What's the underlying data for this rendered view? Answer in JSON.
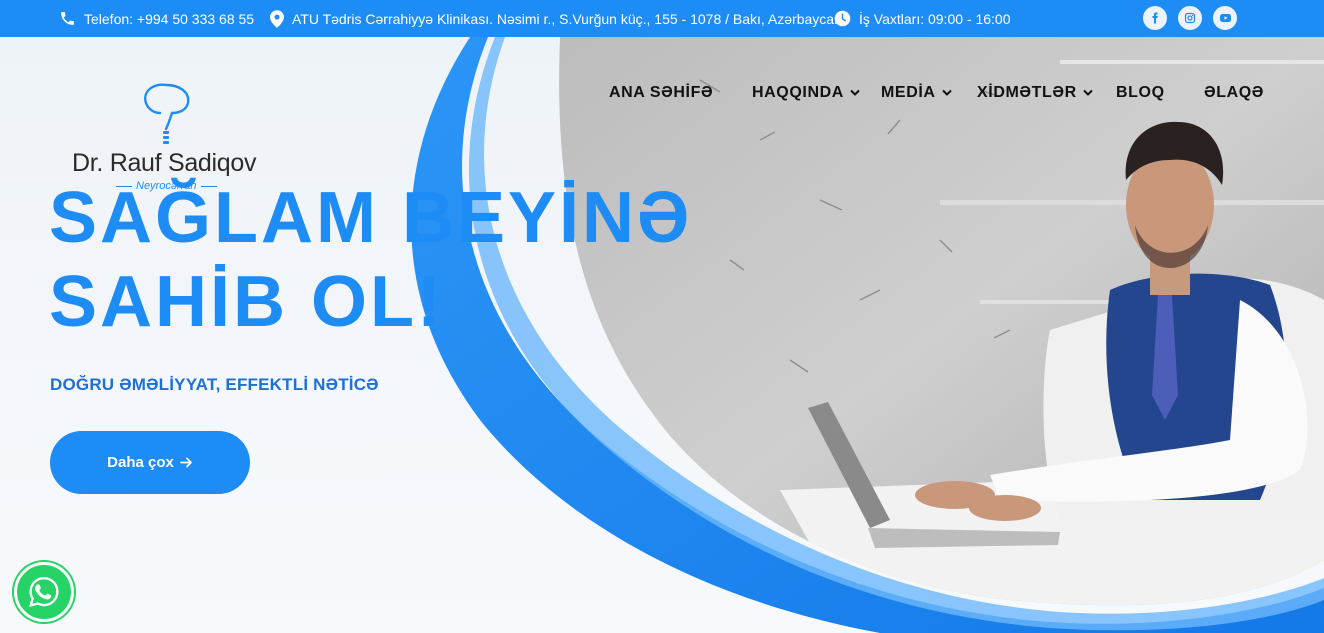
{
  "topbar": {
    "phone": "Telefon: +994 50 333 68 55",
    "address": "ATU Tədris Cərrahiyyə Klinikası. Nəsimi r., S.Vurğun küç., 155 - 1078 / Bakı, Azərbaycan",
    "hours": "İş Vaxtları: 09:00 - 16:00",
    "icons": {
      "phone": "phone-icon",
      "address": "map-pin-icon",
      "hours": "clock-icon"
    },
    "socials": [
      "facebook-icon",
      "instagram-icon",
      "youtube-icon"
    ]
  },
  "logo": {
    "name": "Dr. Rauf Sadiqov",
    "subtitle": "Neyrocərrah"
  },
  "nav": {
    "items": [
      {
        "label": "ANA SƏHİFƏ",
        "has_dropdown": false
      },
      {
        "label": "HAQQINDA",
        "has_dropdown": true
      },
      {
        "label": "MEDİA",
        "has_dropdown": true
      },
      {
        "label": "XİDMƏTLƏR",
        "has_dropdown": true
      },
      {
        "label": "BLOQ",
        "has_dropdown": false
      },
      {
        "label": "ƏLAQƏ",
        "has_dropdown": false
      }
    ]
  },
  "hero": {
    "headline_line1": "SAĞLAM BEYİNƏ",
    "headline_line2": "SAHİB OL!",
    "subheadline": "DOĞRU ƏMƏLİYYAT, EFFEKTLİ NƏTİCƏ",
    "cta_label": "Daha çox",
    "cta_icon": "arrow-right-icon"
  },
  "floating": {
    "whatsapp_icon": "whatsapp-icon"
  },
  "colors": {
    "brand_blue": "#1e8cf5",
    "topbar_bg": "#1e8cf5",
    "headline": "#1e8cf5",
    "whatsapp": "#25d366"
  }
}
